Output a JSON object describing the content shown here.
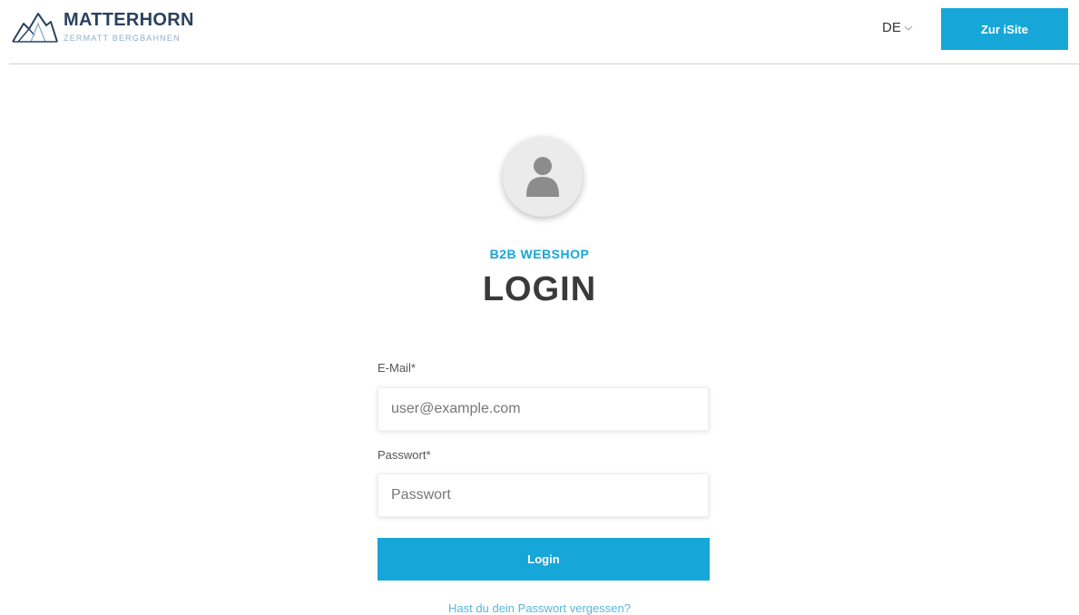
{
  "header": {
    "logo": {
      "title": "MATTERHORN",
      "subtitle": "ZERMATT BERGBAHNEN",
      "icon": "mountain-logo-icon"
    },
    "language": {
      "selected": "DE",
      "icon": "chevron-down-icon"
    },
    "isite_button_label": "Zur iSite"
  },
  "login": {
    "avatar_icon": "user-icon",
    "subtitle": "B2B WEBSHOP",
    "title": "LOGIN",
    "email": {
      "label": "E-Mail*",
      "placeholder": "user@example.com",
      "value": ""
    },
    "password": {
      "label": "Passwort*",
      "placeholder": "Passwort",
      "value": ""
    },
    "submit_label": "Login",
    "forgot_link": "Hast du dein Passwort vergessen?"
  },
  "colors": {
    "accent": "#17a6d8",
    "brand_dark": "#29415f",
    "brand_light": "#8fb0cf",
    "heading": "#3a3a3a"
  }
}
